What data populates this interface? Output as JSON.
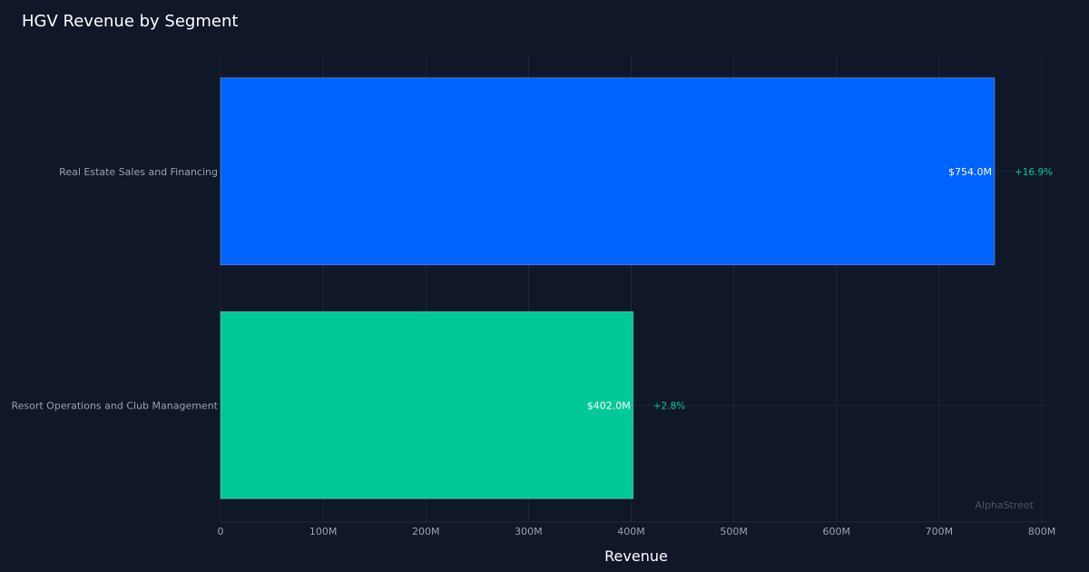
{
  "chart_data": {
    "type": "bar",
    "orientation": "horizontal",
    "title": "HGV Revenue by Segment",
    "xlabel": "Revenue",
    "ylabel": "",
    "xlim": [
      0,
      810
    ],
    "x_ticks": [
      0,
      100,
      200,
      300,
      400,
      500,
      600,
      700,
      800
    ],
    "x_tick_labels": [
      "0",
      "100M",
      "200M",
      "300M",
      "400M",
      "500M",
      "600M",
      "700M",
      "800M"
    ],
    "grid": true,
    "categories": [
      "Real Estate Sales and Financing",
      "Resort Operations and Club Management"
    ],
    "values": [
      754.0,
      402.0
    ],
    "value_labels": [
      "$754.0M",
      "$402.0M"
    ],
    "change_labels": [
      "+16.9%",
      "+2.8%"
    ],
    "bar_colors": [
      "#0062ff",
      "#00c896"
    ],
    "change_color": "#00c896"
  },
  "watermark": "AlphaStreet"
}
